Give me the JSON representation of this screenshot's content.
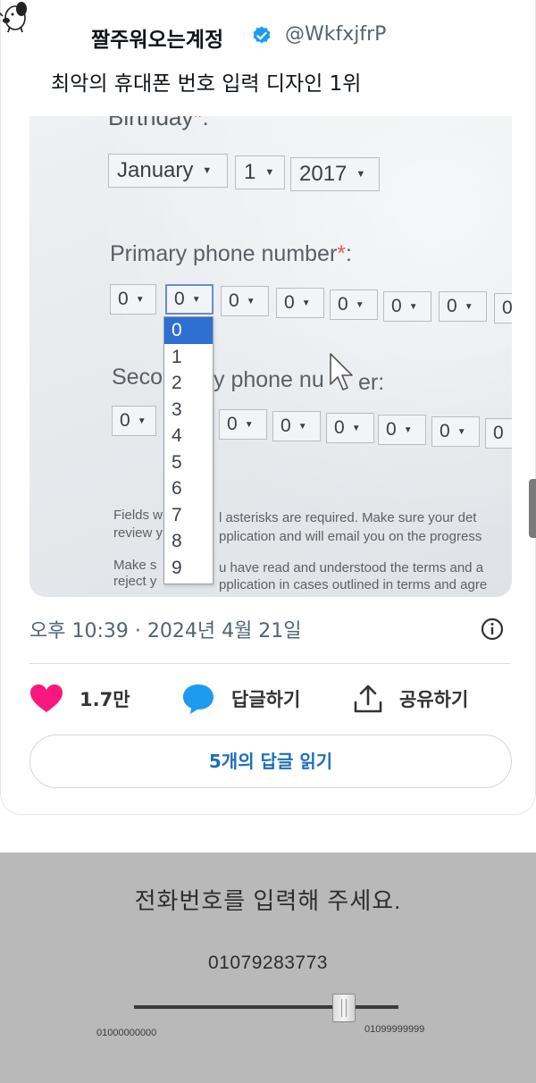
{
  "tweet": {
    "display_name": "짤주워오는계정",
    "handle": "@WkfxjfrP",
    "text": "최악의 휴대폰 번호 입력 디자인 1위",
    "timestamp": "오후 10:39 · 2024년 4월 21일",
    "likes": "1.7만",
    "reply_label": "답글하기",
    "share_label": "공유하기",
    "read_replies_label": "5개의 답글 읽기",
    "icons": {
      "avatar": "snoopy-avatar-icon",
      "verified": "verified-badge-icon",
      "info": "info-icon",
      "like": "heart-icon",
      "reply": "speech-bubble-icon",
      "share": "share-upload-icon"
    },
    "colors": {
      "like": "#f91880",
      "reply": "#1d9bf0",
      "link": "#1d6fb9",
      "verified": "#1d9bf0"
    }
  },
  "photo": {
    "birthday_label": "Birthday",
    "birthday_month": "January",
    "birthday_day": "1",
    "birthday_year": "2017",
    "primary_label": "Primary phone number",
    "primary_digits": [
      "0",
      "0",
      "0",
      "0",
      "0",
      "0",
      "0",
      "0"
    ],
    "secondary_label_left": "Seco",
    "secondary_label_right": "y phone nu",
    "secondary_label_end": "er:",
    "secondary_digits": [
      "0",
      "0",
      "0",
      "0",
      "0",
      "0",
      "0"
    ],
    "dropdown_options": [
      "0",
      "1",
      "2",
      "3",
      "4",
      "5",
      "6",
      "7",
      "8",
      "9"
    ],
    "dropdown_selected": "0",
    "fine_print": [
      {
        "left": "Fields w",
        "right": "l asterisks are required. Make sure your det"
      },
      {
        "left": "review y",
        "right": "pplication and will email you on the progress"
      },
      {
        "left": "Make s",
        "right": "u have read and understood the terms and a"
      },
      {
        "left": "reject y",
        "right": "pplication in cases outlined in terms and agre"
      }
    ]
  },
  "slider_ui": {
    "title": "전화번호를 입력해 주세요.",
    "value": "01079283773",
    "min_label": "01000000000",
    "max_label": "01099999999",
    "fraction": 0.7928
  }
}
